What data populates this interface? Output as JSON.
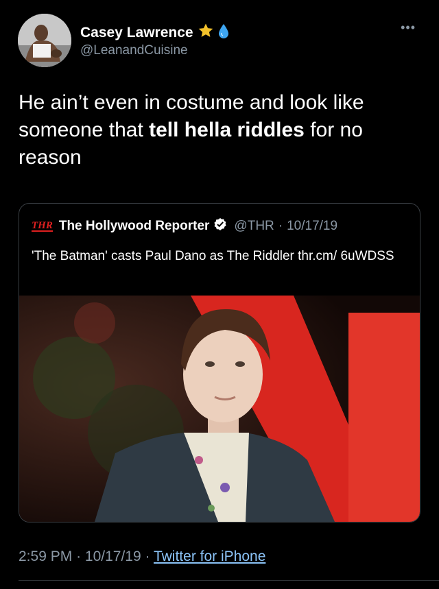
{
  "author": {
    "name": "Casey Lawrence",
    "handle": "@LeanandCuisine",
    "badges": [
      "star-icon",
      "droplet-icon"
    ]
  },
  "tweet": {
    "text_part1": "He ain’t even in costume and look like someone that ",
    "text_bold": "tell hella riddles",
    "text_part2": " for no reason"
  },
  "quoted_tweet": {
    "logo_text": "THR",
    "name": "The Hollywood Reporter",
    "handle": "@THR",
    "date": "10/17/19",
    "separator": "·",
    "text": "'The Batman' casts Paul Dano as The Riddler thr.cm/ 6uWDSS"
  },
  "meta": {
    "time": "2:59 PM",
    "date": "10/17/19",
    "separator": "·",
    "source": "Twitter for iPhone"
  },
  "colors": {
    "background": "#000000",
    "secondary_text": "#8b98a5",
    "link": "#8bc3f7",
    "verified": "#ffffff",
    "thr_red": "#e02020"
  }
}
